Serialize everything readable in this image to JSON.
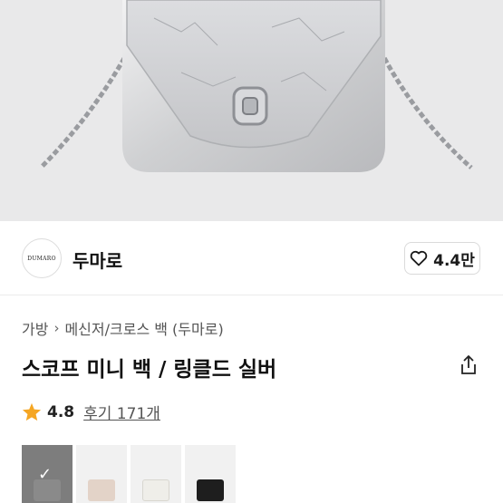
{
  "brand": {
    "logo_text": "DUMARO",
    "name": "두마로",
    "likes": "4.4만"
  },
  "breadcrumb": {
    "category": "가방",
    "subcategory": "메신저/크로스 백 (두마로)"
  },
  "product": {
    "title": "스코프 미니 백 / 링클드 실버"
  },
  "rating": {
    "score": "4.8",
    "review_label": "후기 171개"
  },
  "colors": {
    "star": "#f5a623",
    "silver_bag": "#d6d7d9",
    "thumb_options": [
      "#8a8a8a",
      "#e3d3c8",
      "#efeee9",
      "#1e1e1e"
    ]
  },
  "icons": {
    "like": "heart-icon",
    "share": "share-icon",
    "breadcrumb_sep": "chevron-right-icon",
    "rating": "star-icon",
    "selected": "check-icon"
  }
}
